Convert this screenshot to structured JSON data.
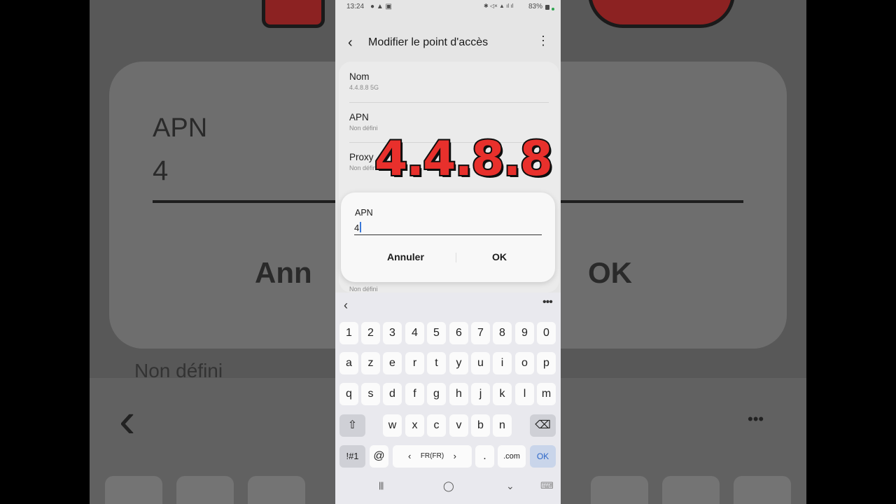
{
  "background": {
    "apn_label": "APN",
    "apn_value": "4",
    "cancel": "Ann",
    "ok": "OK",
    "undefined": "Non défini",
    "back": "‹",
    "more": "•••"
  },
  "status_bar": {
    "time": "13:24",
    "left_icons": "● ▲ ▣",
    "right_icons": "✱ ◁× ▲ ıl ıl",
    "battery": "83%"
  },
  "header": {
    "back": "‹",
    "title": "Modifier le point d'accès",
    "more": "⋮"
  },
  "settings": [
    {
      "label": "Nom",
      "value": "4.4.8.8 5G"
    },
    {
      "label": "APN",
      "value": "Non défini"
    },
    {
      "label": "Proxy",
      "value": "Non défini"
    }
  ],
  "hidden_row_value": "Non défini",
  "overlay_text": "4.4.8.8",
  "dialog": {
    "label": "APN",
    "value": "4",
    "cancel": "Annuler",
    "ok": "OK"
  },
  "keyboard": {
    "back": "‹",
    "more": "•••",
    "row1": [
      "1",
      "2",
      "3",
      "4",
      "5",
      "6",
      "7",
      "8",
      "9",
      "0"
    ],
    "row2": [
      "a",
      "z",
      "e",
      "r",
      "t",
      "y",
      "u",
      "i",
      "o",
      "p"
    ],
    "row3": [
      "q",
      "s",
      "d",
      "f",
      "g",
      "h",
      "j",
      "k",
      "l",
      "m"
    ],
    "row4": [
      "w",
      "x",
      "c",
      "v",
      "b",
      "n"
    ],
    "shift": "⇧",
    "backspace": "⌫",
    "symbols": "!#1",
    "at": "@",
    "lang_left": "‹",
    "lang": "FR(FR)",
    "lang_right": "›",
    "dot": ".",
    "dotcom": ".com",
    "ok": "OK"
  },
  "nav_bar": {
    "recents": "|||",
    "home": "◯",
    "back": "⌄",
    "keyboard": "⌨"
  },
  "colors": {
    "overlay_fill": "#e8302c",
    "accent": "#2d67c8"
  }
}
